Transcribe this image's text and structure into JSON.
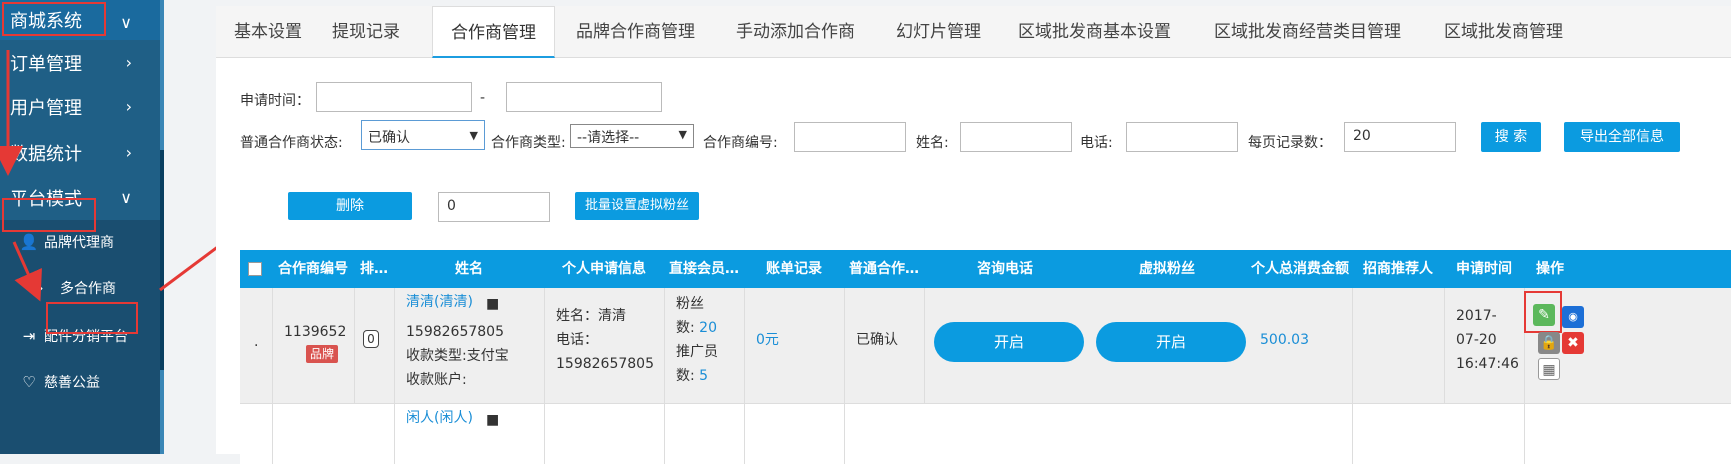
{
  "sidebar": {
    "top": "商城系统",
    "items": [
      {
        "label": "订单管理"
      },
      {
        "label": "用户管理"
      },
      {
        "label": "数据统计"
      },
      {
        "label": "平台模式"
      }
    ],
    "subitems": [
      {
        "label": "品牌代理商",
        "icon": "user-icon"
      },
      {
        "label": "多合作商",
        "icon": "double-chevron-icon"
      },
      {
        "label": "配件分销平台",
        "icon": "export-icon"
      },
      {
        "label": "慈善公益",
        "icon": "heart-icon"
      }
    ]
  },
  "tabs": [
    "基本设置",
    "提现记录",
    "合作商管理",
    "品牌合作商管理",
    "手动添加合作商",
    "幻灯片管理",
    "区域批发商基本设置",
    "区域批发商经营类目管理",
    "区域批发商管理"
  ],
  "filters": {
    "apply_time_label": "申请时间：",
    "apply_time_sep": "-",
    "status_label": "普通合作商状态:",
    "status_value": "已确认",
    "type_label": "合作商类型:",
    "type_value": "--请选择--",
    "code_label": "合作商编号:",
    "name_label": "姓名:",
    "phone_label": "电话:",
    "per_page_label": "每页记录数：",
    "per_page_value": "20",
    "search_btn": "搜 索",
    "export_btn": "导出全部信息"
  },
  "actions": {
    "delete_btn": "删除",
    "fans_value": "0",
    "batch_btn": "批量设置虚拟粉丝"
  },
  "table": {
    "headers": [
      "合作商编号",
      "排…",
      "姓名",
      "个人申请信息",
      "直接会员…",
      "账单记录",
      "普通合作…",
      "咨询电话",
      "虚拟粉丝",
      "个人总消费金额",
      "招商推荐人",
      "申请时间",
      "操作"
    ],
    "row1": {
      "dot": "·",
      "code": "1139652",
      "brand_badge": "品牌",
      "sort": "0",
      "name_link": "清清(清清)",
      "phone": "15982657805",
      "pay_type": "收款类型:支付宝",
      "pay_account": "收款账户:",
      "apply_name": "姓名：清清",
      "apply_phone_label": "电话：",
      "apply_phone": "15982657805",
      "fans_label": "粉丝",
      "fans_count_label": "数:",
      "fans_count": "20",
      "promoter_label": "推广员",
      "promoter_count_label": "数:",
      "promoter_count": "5",
      "bill": "0元",
      "status": "已确认",
      "consult_btn": "开启",
      "virtual_btn": "开启",
      "total": "500.03",
      "date1": "2017-",
      "date2": "07-20",
      "date3": "16:47:46"
    },
    "row2": {
      "name_link": "闲人(闲人)"
    }
  }
}
